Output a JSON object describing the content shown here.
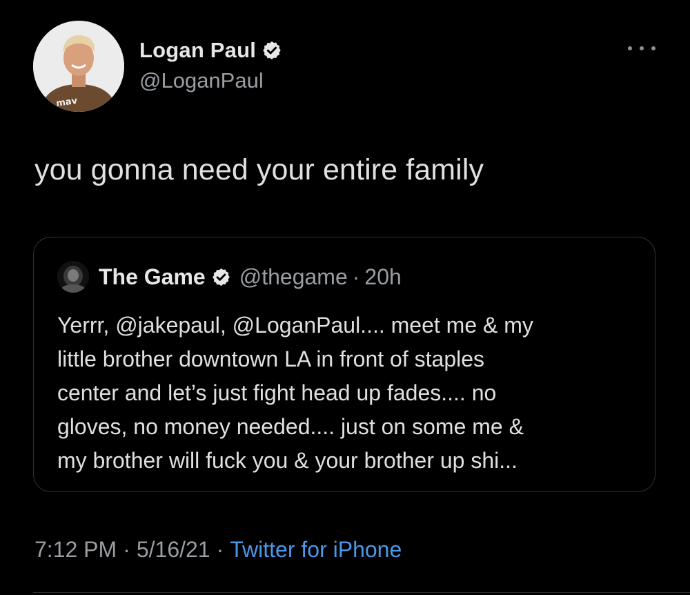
{
  "tweet": {
    "author": {
      "display_name": "Logan Paul",
      "handle": "@LoganPaul",
      "avatar_icon": "profile-photo",
      "shirt_logo": "mav",
      "verified": true
    },
    "more_icon": "more-horizontal-icon",
    "text": "you gonna need your entire family",
    "quote": {
      "display_name": "The Game",
      "handle": "@thegame",
      "separator": "·",
      "time": "20h",
      "verified": true,
      "lines": [
        "Yerrr, @jakepaul, @LoganPaul.... meet me & my",
        "little brother downtown LA in front of staples",
        "center and let’s just fight head up fades.... no",
        "gloves, no money needed.... just on some me &",
        "my brother will fuck you & your brother up shi..."
      ]
    },
    "meta": {
      "time": "7:12 PM",
      "sep1": "·",
      "date": "5/16/21",
      "sep2": "·",
      "source": "Twitter for iPhone"
    }
  },
  "colors": {
    "background": "#000000",
    "primary_text": "#e7e7e7",
    "secondary_text": "#9a9ea3",
    "link": "#4a99e9",
    "border": "#2f3336",
    "verified_badge": "#e7e7e7"
  }
}
